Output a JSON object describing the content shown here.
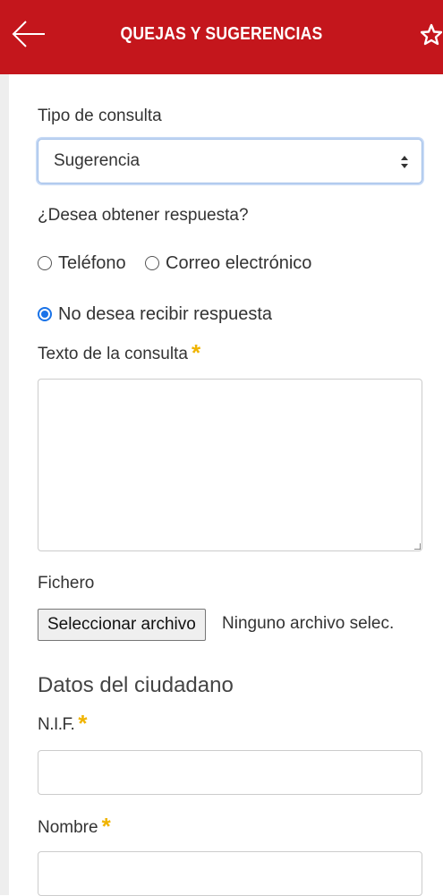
{
  "header": {
    "title": "QUEJAS Y SUGERENCIAS",
    "back_icon": "arrow-left-icon",
    "favorite_icon": "star-outline-icon",
    "background_color": "#c4161c",
    "text_color": "#ffffff"
  },
  "form": {
    "tipo_consulta": {
      "label": "Tipo de consulta",
      "selected": "Sugerencia"
    },
    "respuesta": {
      "label": "¿Desea obtener respuesta?",
      "options": [
        {
          "label": "Teléfono",
          "checked": false
        },
        {
          "label": "Correo electrónico",
          "checked": false
        },
        {
          "label": "No desea recibir respuesta",
          "checked": true
        }
      ]
    },
    "texto_consulta": {
      "label": "Texto de la consulta",
      "required_mark": "*",
      "value": ""
    },
    "fichero": {
      "label": "Fichero",
      "button_label": "Seleccionar archivo",
      "status": "Ninguno archivo selec."
    },
    "ciudadano": {
      "section_title": "Datos del ciudadano",
      "nif": {
        "label": "N.I.F.",
        "required_mark": "*",
        "value": ""
      },
      "nombre": {
        "label": "Nombre",
        "required_mark": "*",
        "value": ""
      }
    }
  },
  "colors": {
    "required_star": "#f0b400",
    "radio_checked": "#1a73e8",
    "select_focus": "#9ebde8"
  }
}
